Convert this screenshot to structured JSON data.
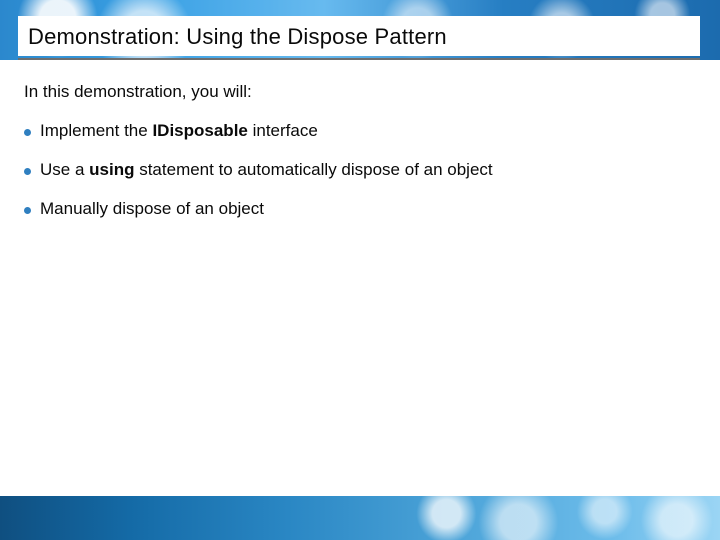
{
  "title": "Demonstration: Using the Dispose Pattern",
  "intro": "In this demonstration, you will:",
  "bullets": [
    {
      "pre": "Implement the ",
      "bold": "IDisposable",
      "post": " interface"
    },
    {
      "pre": "Use a ",
      "bold": "using",
      "post": " statement to automatically dispose of an object"
    },
    {
      "pre": "Manually dispose of an object",
      "bold": "",
      "post": ""
    }
  ],
  "theme": {
    "accent": "#2f7fc0",
    "underline": "#6e6e6e"
  }
}
